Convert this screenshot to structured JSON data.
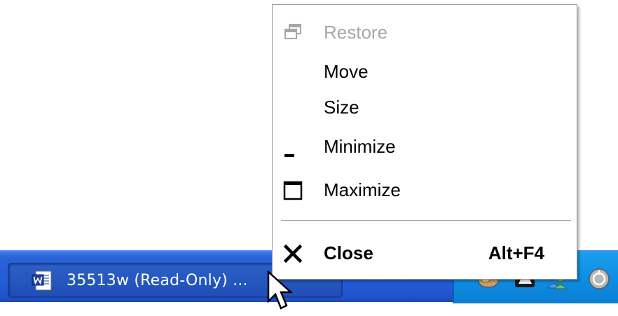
{
  "context_menu": {
    "items": [
      {
        "label": "Restore",
        "icon": "restore-icon",
        "enabled": false
      },
      {
        "label": "Move",
        "icon": "",
        "enabled": true
      },
      {
        "label": "Size",
        "icon": "",
        "enabled": true
      },
      {
        "label": "Minimize",
        "icon": "minimize-icon",
        "enabled": true
      },
      {
        "label": "Maximize",
        "icon": "maximize-icon",
        "enabled": true
      },
      {
        "label": "Close",
        "icon": "close-icon",
        "enabled": true,
        "shortcut": "Alt+F4",
        "bold": true
      }
    ]
  },
  "taskbar": {
    "task_button": {
      "label": "35513w (Read-Only) ...",
      "icon": "word-document-icon"
    },
    "tray_icons": [
      "network-icon",
      "security-icon",
      "chat-icon",
      "update-icon"
    ]
  },
  "colors": {
    "taskbar_blue": "#245ddb",
    "tray_blue": "#0e8ee4",
    "disabled_text": "#a7a7a7"
  }
}
